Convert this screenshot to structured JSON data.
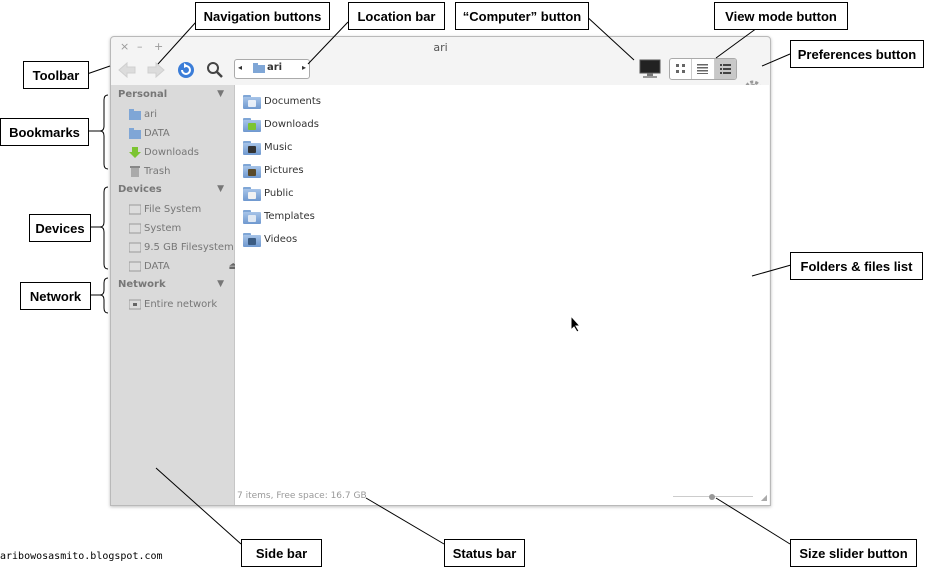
{
  "window": {
    "title": "ari",
    "controls": {
      "close": "×",
      "minimize": "–",
      "maximize": "+"
    }
  },
  "toolbar": {
    "back_icon": "back-arrow-icon",
    "forward_icon": "forward-arrow-icon",
    "reload_icon": "reload-icon",
    "search_icon": "search-icon",
    "location": {
      "left_arrow": "◂",
      "crumb": "ari",
      "right_arrow": "▸"
    },
    "computer_icon": "computer-icon",
    "view_modes": [
      "icon-view-icon",
      "list-view-icon",
      "column-view-icon"
    ],
    "active_view": 2,
    "prefs_icon": "gear-icon"
  },
  "sidebar": {
    "sections": [
      {
        "title": "Personal",
        "items": [
          "ari",
          "DATA",
          "Downloads",
          "Trash"
        ]
      },
      {
        "title": "Devices",
        "items": [
          "File System",
          "System",
          "9.5 GB Filesystem",
          "DATA"
        ]
      },
      {
        "title": "Network",
        "items": [
          "Entire network"
        ]
      }
    ],
    "collapse_glyph": "▼",
    "eject_glyph": "⏏"
  },
  "files": [
    "Documents",
    "Downloads",
    "Music",
    "Pictures",
    "Public",
    "Templates",
    "Videos"
  ],
  "status": "7 items, Free space: 16.7 GB",
  "annotations": {
    "toolbar": "Toolbar",
    "navigation": "Navigation buttons",
    "location": "Location bar",
    "computer": "“Computer” button",
    "view_mode": "View mode button",
    "preferences": "Preferences button",
    "bookmarks": "Bookmarks",
    "devices": "Devices",
    "network": "Network",
    "files_list": "Folders & files list",
    "side_bar": "Side bar",
    "status_bar": "Status bar",
    "size_slider": "Size slider button"
  },
  "credit": "aribowosasmito.blogspot.com",
  "colors": {
    "folder": "#7fa6d6",
    "sidebar": "#dadada",
    "accent": "#3b7dd8"
  }
}
